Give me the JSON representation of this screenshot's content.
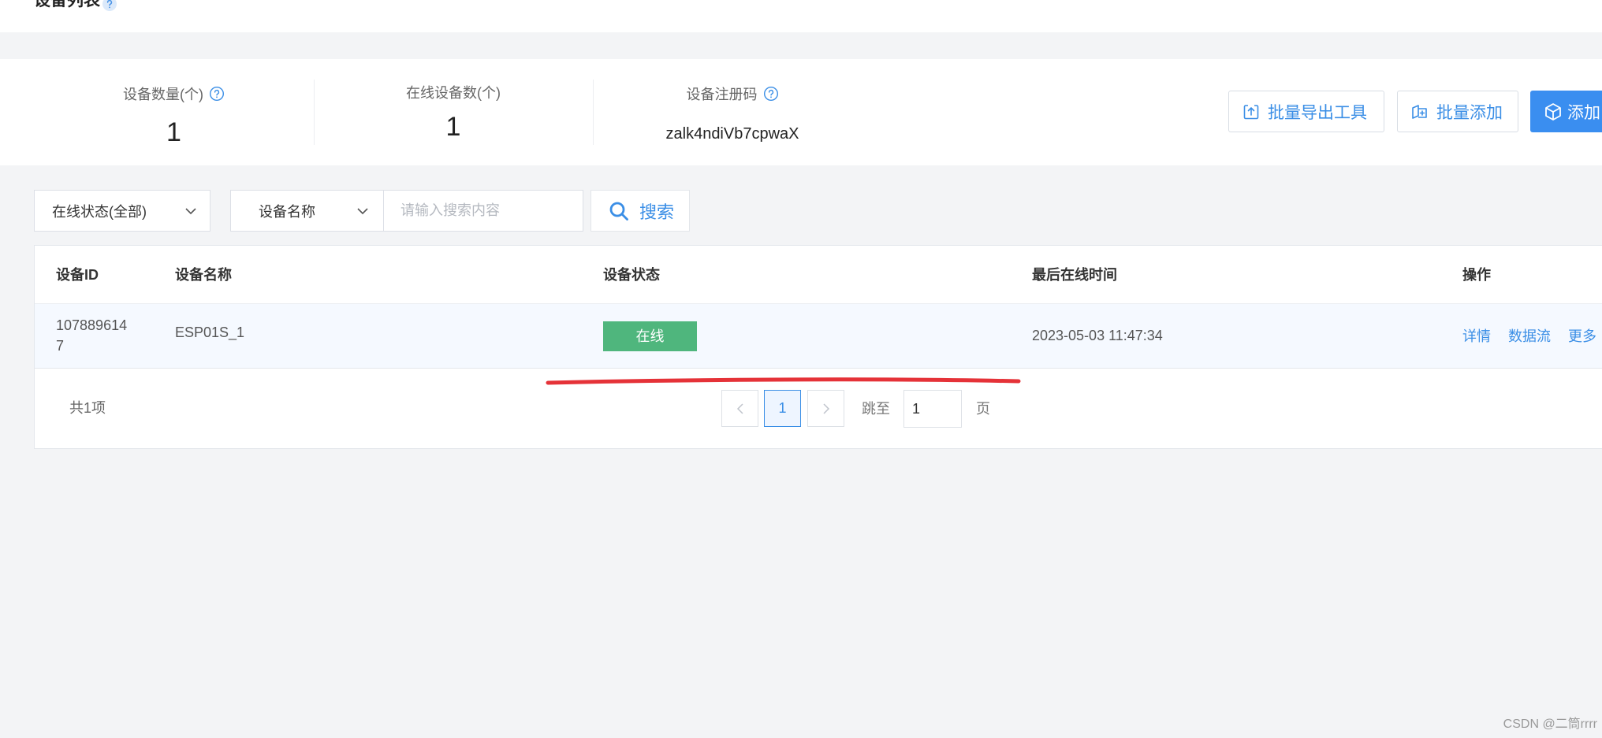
{
  "header": {
    "title": "设备列表",
    "help_icon": "question-circle-icon"
  },
  "stats": [
    {
      "label": "设备数量(个)",
      "value": "1",
      "icon": "question-circle-icon"
    },
    {
      "label": "在线设备数(个)",
      "value": "1"
    },
    {
      "label": "设备注册码",
      "value": "zalk4ndiVb7cpwaX",
      "icon": "question-circle-icon"
    }
  ],
  "toolbar": {
    "export_label": "批量导出工具",
    "export_icon": "upload-icon",
    "batch_add_label": "批量添加",
    "batch_add_icon": "batch-add-icon",
    "add_label": "添加",
    "add_icon": "cube-icon"
  },
  "filters": {
    "status_select_value": "在线状态(全部)",
    "field_select_value": "设备名称",
    "search_placeholder": "请输入搜索内容",
    "search_button_label": "搜索",
    "search_icon": "search-icon"
  },
  "table": {
    "columns": [
      "设备ID",
      "设备名称",
      "设备状态",
      "最后在线时间",
      "操作"
    ],
    "rows": [
      {
        "id": "1078896147",
        "name": "ESP01S_1",
        "status": "在线",
        "last_online": "2023-05-03 11:47:34",
        "actions": [
          "详情",
          "数据流",
          "更多"
        ]
      }
    ]
  },
  "pagination": {
    "total_text": "共1项",
    "current_page": "1",
    "jump_label": "跳至",
    "jump_value": "1",
    "page_suffix": "页"
  },
  "watermark": "CSDN @二筒rrrr",
  "colors": {
    "accent": "#3a8ee6",
    "primary_button": "#3a8ef0",
    "online_badge": "#4fb67d",
    "annotation": "#e53238",
    "page_background": "#f3f4f6"
  }
}
